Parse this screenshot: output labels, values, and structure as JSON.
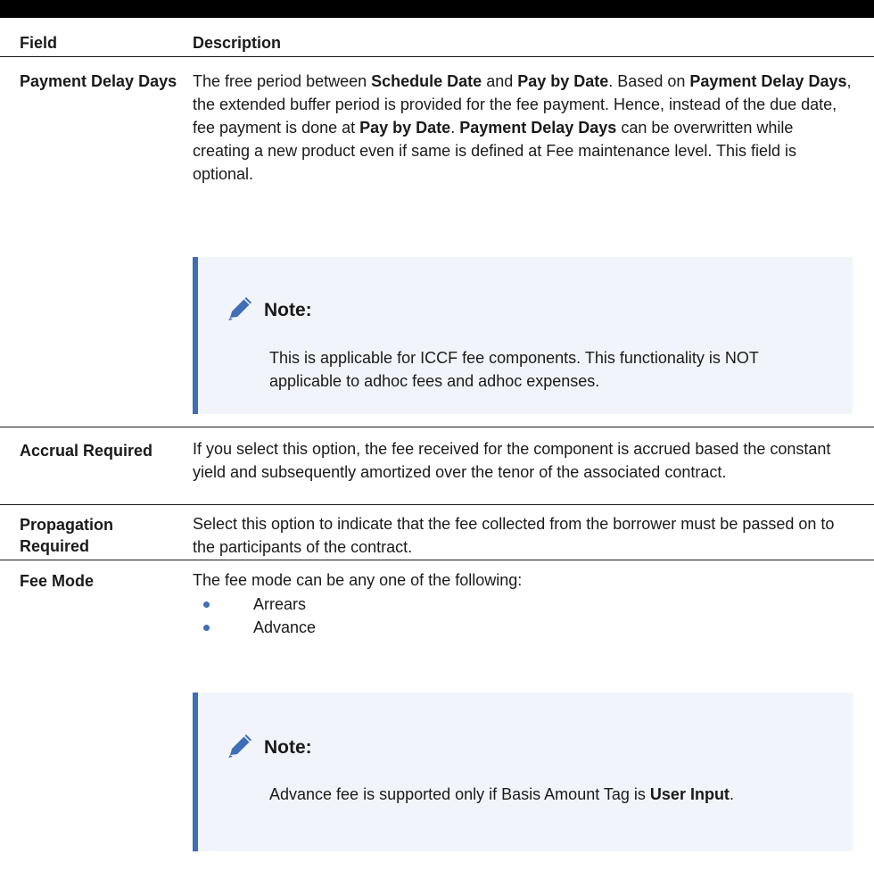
{
  "header": {
    "field": "Field",
    "description": "Description"
  },
  "rows": [
    {
      "field": "Payment Delay Days",
      "description": {
        "t1": "The free period between ",
        "b1": "Schedule Date",
        "t2": " and ",
        "b2": "Pay by Date",
        "t3": ". Based on ",
        "b3": "Payment Delay Days",
        "t4": ", the extended buffer period is provided for the fee payment. Hence, instead of the due date, fee payment is done at ",
        "b4": "Pay by Date",
        "t5": ". ",
        "b5": "Payment Delay Days",
        "t6": " can be overwritten while creating a new product even if same is defined at Fee maintenance level. This field is optional."
      },
      "note": {
        "title": "Note:",
        "body": "This is applicable for ICCF fee components. This functionality is NOT applicable to adhoc fees and adhoc expenses."
      }
    },
    {
      "field": "Accrual Required",
      "description": "If you select this option, the fee received for the component is accrued based the constant yield and subsequently amortized over the tenor of the associated contract."
    },
    {
      "field": "Propagation Required",
      "description": "Select this option to indicate that the fee collected from the borrower must be passed on to the participants of the contract."
    },
    {
      "field": "Fee Mode",
      "description": "The fee mode can be any one of the following:",
      "bullets": [
        "Arrears",
        "Advance"
      ],
      "note": {
        "title": "Note:",
        "t1": "Advance fee is supported only if Basis Amount Tag is ",
        "b1": "User Input",
        "t2": "."
      }
    }
  ],
  "colors": {
    "accent": "#3f6db6",
    "note_bg": "#f1f5fb"
  },
  "icons": {
    "note": "pencil-icon"
  }
}
